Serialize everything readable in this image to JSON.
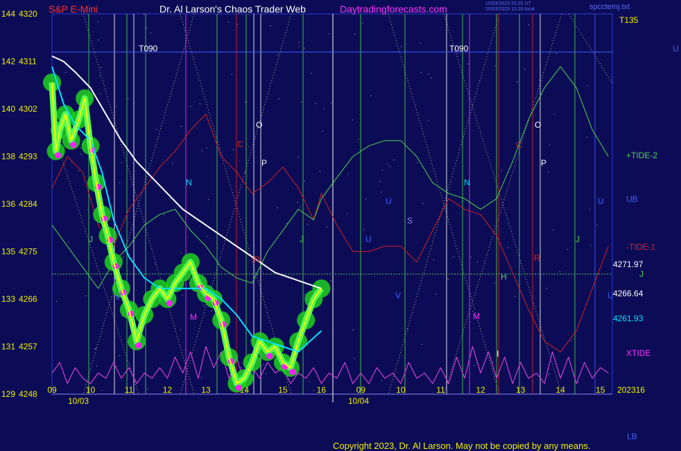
{
  "header": {
    "symbol": "S&P E-Mini",
    "title": "Dr. Al Larson's Chaos Trader Web",
    "site": "Daytradingforecasts.com",
    "stamp1": "10/03/2023 20:20 UT",
    "stamp2": "10/03/2023 15:20 local",
    "file": "spcctemj.txt",
    "tag_top_right": "T135"
  },
  "footer": {
    "copyright": "Copyright 2023, Dr. Al Larson. May not be copied by any means.",
    "lb": "LB",
    "year": "2023"
  },
  "colors": {
    "background": "#0c0c56",
    "price": "#ffff00",
    "price_glow": "#1fd11f",
    "ema_fast": "#00e5ff",
    "ema_slow": "#ffffff",
    "tide2": "#4fd64f",
    "tide1": "#d02020",
    "xtide": "#d040d0",
    "grid_blue": "#2a3cd8",
    "marker_magenta": "#ff20ff",
    "label_yellow": "#f0f000"
  },
  "chart_data": {
    "type": "line",
    "title": "S&P E-Mini",
    "y_left_cycle": {
      "ticks": [
        144,
        142,
        140,
        138,
        136,
        135,
        133,
        131,
        129
      ]
    },
    "y_price": {
      "ticks": [
        4320,
        4311,
        4302,
        4293,
        4284,
        4275,
        4266,
        4257,
        4248
      ],
      "range": [
        4248,
        4320
      ]
    },
    "x_hour_labels": [
      "09",
      "10",
      "11",
      "12",
      "13",
      "14",
      "15",
      "16",
      "09",
      "10",
      "11",
      "12",
      "13",
      "14",
      "15",
      "16"
    ],
    "x_date_labels": [
      "10/03",
      "10/04"
    ],
    "price_last": "4271.97",
    "ema_fast_last": "4261.93",
    "ema_slow_last": "4266.64",
    "series": [
      {
        "name": "price",
        "x": [
          9.0,
          9.1,
          9.2,
          9.35,
          9.5,
          9.7,
          9.85,
          10.0,
          10.15,
          10.3,
          10.45,
          10.6,
          10.8,
          11.0,
          11.2,
          11.4,
          11.6,
          11.8,
          12.0,
          12.2,
          12.4,
          12.6,
          12.8,
          13.0,
          13.2,
          13.4,
          13.6,
          13.8,
          14.0,
          14.2,
          14.4,
          14.6,
          14.8,
          15.0,
          15.2,
          15.4,
          15.6,
          15.8,
          16.0
        ],
        "y": [
          4307,
          4294,
          4298,
          4301,
          4296,
          4300,
          4304,
          4295,
          4288,
          4282,
          4278,
          4273,
          4268,
          4264,
          4258,
          4263,
          4266,
          4268,
          4266,
          4269,
          4271,
          4273,
          4269,
          4267,
          4266,
          4262,
          4255,
          4250,
          4251,
          4254,
          4258,
          4256,
          4257,
          4254,
          4253,
          4258,
          4262,
          4266,
          4268
        ]
      },
      {
        "name": "EMA fast",
        "x": [
          9.0,
          9.3,
          9.6,
          10.0,
          10.3,
          10.6,
          11.0,
          11.4,
          11.8,
          12.2,
          12.6,
          13.0,
          13.4,
          13.8,
          14.2,
          14.6,
          15.0,
          15.4,
          16.0
        ],
        "y": [
          4310,
          4303,
          4299,
          4296,
          4290,
          4281,
          4274,
          4270,
          4268,
          4268,
          4268,
          4268,
          4266,
          4263,
          4259,
          4258,
          4257,
          4256,
          4260
        ]
      },
      {
        "name": "EMA slow",
        "x": [
          9.0,
          9.3,
          9.6,
          10.0,
          10.4,
          10.8,
          11.2,
          11.6,
          12.0,
          12.4,
          12.8,
          13.2,
          13.6,
          14.0,
          14.4,
          14.8,
          15.2,
          15.6,
          16.0
        ],
        "y": [
          4312,
          4311,
          4309,
          4306,
          4301,
          4296,
          4292,
          4289,
          4286,
          4283,
          4281,
          4279,
          4277,
          4275,
          4273,
          4271,
          4270,
          4269,
          4268
        ]
      },
      {
        "name": "+TIDE-2",
        "x": [
          9.0,
          9.4,
          9.8,
          10.2,
          10.6,
          11.0,
          11.4,
          11.8,
          12.2,
          12.6,
          13.0,
          13.4,
          13.8,
          14.2,
          14.6,
          15.0,
          15.4,
          15.8,
          16.0,
          16.4,
          16.8,
          17.2,
          17.6,
          18.0,
          18.4,
          18.8,
          19.2,
          19.6,
          20.0,
          20.4,
          20.8,
          21.2,
          21.6,
          22.0,
          22.4,
          22.8,
          23.2
        ],
        "y": [
          4280,
          4276,
          4272,
          4268,
          4273,
          4276,
          4280,
          4282,
          4283,
          4279,
          4276,
          4272,
          4270,
          4269,
          4275,
          4279,
          4283,
          4281,
          4285,
          4289,
          4293,
          4295,
          4296,
          4296,
          4293,
          4288,
          4286,
          4285,
          4283,
          4285,
          4292,
          4300,
          4306,
          4310,
          4306,
          4298,
          4293
        ]
      },
      {
        "name": "-TIDE-1",
        "x": [
          9.0,
          9.4,
          9.8,
          10.2,
          10.6,
          11.0,
          11.4,
          11.8,
          12.2,
          12.6,
          13.0,
          13.4,
          13.8,
          14.2,
          14.6,
          15.0,
          15.4,
          15.8,
          16.0,
          16.4,
          16.8,
          17.2,
          17.6,
          18.0,
          18.4,
          18.8,
          19.2,
          19.6,
          20.0,
          20.4,
          20.8,
          21.2,
          21.6,
          22.0,
          22.4,
          22.8,
          23.2
        ],
        "y": [
          4287,
          4293,
          4290,
          4280,
          4276,
          4283,
          4287,
          4291,
          4294,
          4298,
          4301,
          4293,
          4290,
          4286,
          4288,
          4291,
          4287,
          4281,
          4286,
          4280,
          4275,
          4275,
          4276,
          4276,
          4273,
          4279,
          4285,
          4283,
          4282,
          4278,
          4271,
          4264,
          4258,
          4256,
          4260,
          4268,
          4276
        ]
      },
      {
        "name": "XTIDE",
        "x": [
          9.0,
          9.2,
          9.4,
          9.6,
          9.8,
          10.0,
          10.2,
          10.4,
          10.6,
          10.8,
          11.0,
          11.2,
          11.4,
          11.6,
          11.8,
          12.0,
          12.2,
          12.4,
          12.6,
          12.8,
          13.0,
          13.2,
          13.4,
          13.6,
          13.8,
          14.0,
          14.2,
          14.4,
          14.6,
          14.8,
          15.0,
          15.2,
          15.4,
          15.6,
          15.8,
          16.0,
          16.2,
          16.4,
          16.6,
          16.8,
          17.0,
          17.2,
          17.4,
          17.6,
          17.8,
          18.0,
          18.2,
          18.4,
          18.6,
          18.8,
          19.0,
          19.2,
          19.4,
          19.6,
          19.8,
          20.0,
          20.2,
          20.4,
          20.6,
          20.8,
          21.0,
          21.2,
          21.4,
          21.6,
          21.8,
          22.0,
          22.2,
          22.4,
          22.6,
          22.8,
          23.0,
          23.2
        ],
        "y": [
          4252,
          4254,
          4250,
          4253,
          4251,
          4250,
          4252,
          4251,
          4254,
          4251,
          4253,
          4250,
          4252,
          4251,
          4253,
          4251,
          4255,
          4252,
          4256,
          4251,
          4257,
          4253,
          4256,
          4251,
          4255,
          4250,
          4253,
          4251,
          4254,
          4252,
          4253,
          4250,
          4252,
          4251,
          4253,
          4250,
          4252,
          4251,
          4254,
          4250,
          4252,
          4250,
          4253,
          4251,
          4252,
          4250,
          4254,
          4251,
          4252,
          4250,
          4253,
          4250,
          4255,
          4251,
          4257,
          4252,
          4256,
          4251,
          4255,
          4250,
          4254,
          4251,
          4252,
          4250,
          4256,
          4251,
          4255,
          4250,
          4254,
          4251,
          4253,
          4252
        ]
      }
    ]
  },
  "annotations": {
    "right_labels": [
      {
        "text": "+TIDE-2",
        "color": "#4fd64f"
      },
      {
        "text": "UB",
        "color": "#4060ff"
      },
      {
        "text": "-TIDE-1",
        "color": "#e02020"
      },
      {
        "text": "4271.97",
        "color": "#ffffff"
      },
      {
        "text": "J",
        "color": "#4fd64f"
      },
      {
        "text": "4266.64",
        "color": "#ffffff"
      },
      {
        "text": "4261.93",
        "color": "#00e5ff"
      },
      {
        "text": "XTIDE",
        "color": "#ff30ff"
      },
      {
        "text": "U",
        "color": "#4060ff"
      }
    ],
    "chart_letters": [
      {
        "text": "T090",
        "color": "#ffffff"
      },
      {
        "text": "T090",
        "color": "#ffffff"
      },
      {
        "text": "O",
        "color": "#ffffff"
      },
      {
        "text": "O",
        "color": "#ffffff"
      },
      {
        "text": "P",
        "color": "#ffffff"
      },
      {
        "text": "P",
        "color": "#ffffff"
      },
      {
        "text": "C",
        "color": "#e02020"
      },
      {
        "text": "C",
        "color": "#e02020"
      },
      {
        "text": "N",
        "color": "#00e5ff"
      },
      {
        "text": "N",
        "color": "#00e5ff"
      },
      {
        "text": "S",
        "color": "#8888ff"
      },
      {
        "text": "J",
        "color": "#4fd64f"
      },
      {
        "text": "J",
        "color": "#4fd64f"
      },
      {
        "text": "J",
        "color": "#4fd64f"
      },
      {
        "text": "U",
        "color": "#4060ff"
      },
      {
        "text": "U",
        "color": "#4060ff"
      },
      {
        "text": "U",
        "color": "#4060ff"
      },
      {
        "text": "U",
        "color": "#4060ff"
      },
      {
        "text": "V",
        "color": "#4060ff"
      },
      {
        "text": "V",
        "color": "#4060ff"
      },
      {
        "text": "M",
        "color": "#ff30ff"
      },
      {
        "text": "M",
        "color": "#ff30ff"
      },
      {
        "text": "R",
        "color": "#e02020"
      },
      {
        "text": "R",
        "color": "#e02020"
      },
      {
        "text": "H",
        "color": "#4fd64f"
      },
      {
        "text": "I",
        "color": "#ffffff"
      }
    ]
  }
}
